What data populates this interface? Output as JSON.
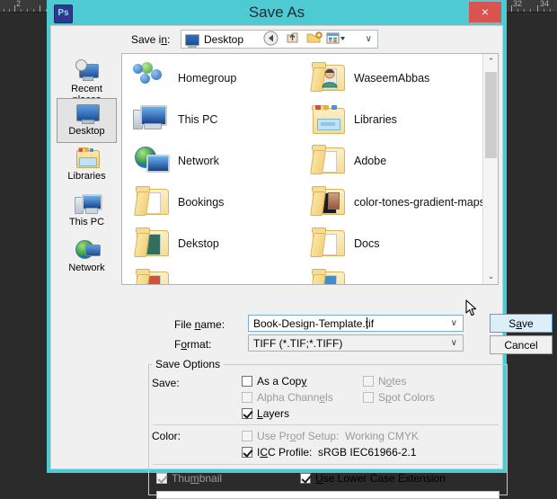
{
  "app": {
    "logo_text": "Ps",
    "title": "Save As",
    "close_label": "×"
  },
  "ruler": {
    "labels": [
      "2",
      "32",
      "34"
    ],
    "unit": "inches"
  },
  "savein": {
    "label": "Save in:",
    "value": "Desktop",
    "arrow": "∨",
    "toolbar": {
      "back": "❮",
      "up": "↑",
      "new_folder": "🗁",
      "views": "▦",
      "views_arrow": "▾"
    }
  },
  "places": {
    "items": [
      {
        "label": "Recent places",
        "selected": false
      },
      {
        "label": "Desktop",
        "selected": true
      },
      {
        "label": "Libraries",
        "selected": false
      },
      {
        "label": "This PC",
        "selected": false
      },
      {
        "label": "Network",
        "selected": false
      }
    ]
  },
  "filelist": {
    "items": [
      {
        "label": "Homegroup",
        "icon": "homegroup-icon",
        "col": 0,
        "row": 0
      },
      {
        "label": "WaseemAbbas",
        "icon": "user-folder-icon",
        "col": 1,
        "row": 0
      },
      {
        "label": "This PC",
        "icon": "computer-icon",
        "col": 0,
        "row": 1
      },
      {
        "label": "Libraries",
        "icon": "libraries-icon",
        "col": 1,
        "row": 1
      },
      {
        "label": "Network",
        "icon": "network-icon",
        "col": 0,
        "row": 2
      },
      {
        "label": "Adobe",
        "icon": "folder-icon",
        "col": 1,
        "row": 2
      },
      {
        "label": "Bookings",
        "icon": "folder-icon",
        "col": 0,
        "row": 3
      },
      {
        "label": "color-tones-gradient-maps",
        "icon": "folder-icon",
        "col": 1,
        "row": 3
      },
      {
        "label": "Dekstop",
        "icon": "folder-icon",
        "col": 0,
        "row": 4
      },
      {
        "label": "Docs",
        "icon": "folder-icon",
        "col": 1,
        "row": 4
      }
    ],
    "scroll_up": "⌃",
    "scroll_down": "⌄"
  },
  "filename": {
    "label": "File name:",
    "label_pre": "File ",
    "label_mnemonic": "n",
    "label_post": "ame:",
    "value": "Book-Design-Template.tif",
    "arrow": "∨"
  },
  "format": {
    "label_pre": "F",
    "label_mnemonic": "o",
    "label_post": "rmat:",
    "value": "TIFF (*.TIF;*.TIFF)",
    "arrow": "∨"
  },
  "buttons": {
    "save_pre": "S",
    "save_mnemonic": "a",
    "save_post": "ve",
    "cancel": "Cancel"
  },
  "save_options": {
    "legend": "Save Options",
    "save_label": "Save:",
    "color_label": "Color:",
    "checkboxes": [
      {
        "name": "as-a-copy",
        "pre": "As a Cop",
        "mn": "y",
        "post": "",
        "checked": false,
        "disabled": false,
        "col": 0,
        "row": 0
      },
      {
        "name": "notes",
        "pre": "N",
        "mn": "o",
        "post": "tes",
        "checked": false,
        "disabled": true,
        "col": 1,
        "row": 0
      },
      {
        "name": "alpha-channels",
        "pre": "Alpha Chann",
        "mn": "e",
        "post": "ls",
        "checked": false,
        "disabled": true,
        "col": 0,
        "row": 1
      },
      {
        "name": "spot-colors",
        "pre": "S",
        "mn": "p",
        "post": "ot Colors",
        "checked": false,
        "disabled": true,
        "col": 1,
        "row": 1
      },
      {
        "name": "layers",
        "pre": "",
        "mn": "L",
        "post": "ayers",
        "checked": true,
        "disabled": false,
        "col": 0,
        "row": 2
      }
    ],
    "proof_setup": {
      "pre": "Use Pr",
      "mn": "o",
      "post": "of Setup:",
      "value": "Working CMYK",
      "checked": false,
      "disabled": true
    },
    "icc_profile": {
      "pre": "I",
      "mn": "C",
      "post": "C Profile:",
      "value": "sRGB IEC61966-2.1",
      "checked": true,
      "disabled": false
    },
    "thumbnail": {
      "pre": "Thu",
      "mn": "m",
      "post": "bnail",
      "checked": true,
      "disabled": true
    },
    "lowercase": {
      "pre": "",
      "mn": "U",
      "post": "se Lower Case Extension",
      "checked": true,
      "disabled": false
    }
  },
  "colors": {
    "titlebar": "#4ecbd2",
    "close": "#d9534f",
    "accent_button": "#ddeefb",
    "canvas": "#2b2b2b"
  }
}
